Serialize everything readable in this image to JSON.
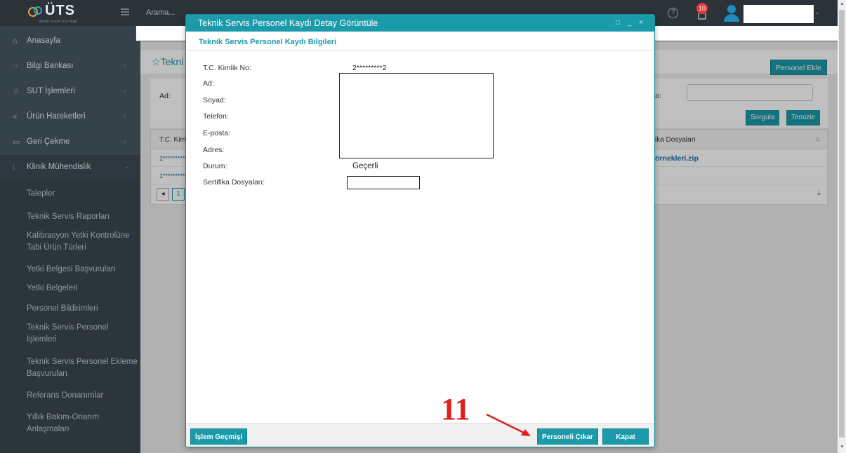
{
  "topbar": {
    "logo_text": "ÜTS",
    "logo_sub": "ÜRÜN TAKİP SİSTEMİ",
    "search_placeholder": "Arama...",
    "notifications_count": "10"
  },
  "sidebar": {
    "items": [
      {
        "label": "Anasayfa",
        "icon": "home-icon"
      },
      {
        "label": "Bilgi Bankası",
        "icon": "lightbulb-icon"
      },
      {
        "label": "SUT İşlemleri",
        "icon": "star-icon"
      },
      {
        "label": "Ürün Hareketleri",
        "icon": "share-icon"
      },
      {
        "label": "Geri Çekme",
        "icon": "monitor-icon"
      },
      {
        "label": "Klinik Mühendislik",
        "icon": "sliders-icon"
      }
    ],
    "sub_items": [
      "Talepler",
      "Teknik Servis Raporları",
      "Kalibrasyon Yetki Kontrolüne Tabi Ürün Türleri",
      "Yetki Belgesi Başvuruları",
      "Yetki Belgeleri",
      "Personel Bildirimleri",
      "Teknik Servis Personel İşlemleri",
      "Teknik Servis Personel Ekleme Başvuruları",
      "Referans Donanımlar",
      "Yıllık Bakım-Onarım Anlaşmaları"
    ]
  },
  "main": {
    "page_title": "☆Tekni",
    "add_button": "Personel Ekle",
    "filter_ad": "Ad:",
    "filter_no": "lo:",
    "search_button": "Sorgula",
    "clear_button": "Temizle",
    "grid": {
      "col1": "T.C. Kiml",
      "col2": "ika Dosyaları",
      "row1_c1": "2**********",
      "row1_c2": "örnekleri.zip",
      "row2_c1": "1**********",
      "page": "1"
    }
  },
  "modal": {
    "title": "Teknik Servis Personel Kaydı Detay Görüntüle",
    "tools": "□ _ ×",
    "section_title": "Teknik Servis Personel Kaydı Bilgileri",
    "fields": [
      {
        "label": "T.C. Kimlik No:",
        "value": "2*********2"
      },
      {
        "label": "Ad:",
        "value": ""
      },
      {
        "label": "Soyad:",
        "value": ""
      },
      {
        "label": "Telefon:",
        "value": ""
      },
      {
        "label": "E-posta:",
        "value": ""
      },
      {
        "label": "Adres:",
        "value": ""
      },
      {
        "label": "Durum:",
        "value": "Geçerli"
      },
      {
        "label": "Sertifika Dosyaları:",
        "value": ""
      }
    ],
    "history_button": "İşlem Geçmişi",
    "remove_button": "Personeli Çıkar",
    "close_button": "Kapat"
  },
  "annotation": {
    "number": "11",
    "color": "#e01e1e"
  },
  "colors": {
    "accent": "#1b9aaa",
    "sidebar_bg": "#364249",
    "topbar_bg": "#2b3338"
  }
}
